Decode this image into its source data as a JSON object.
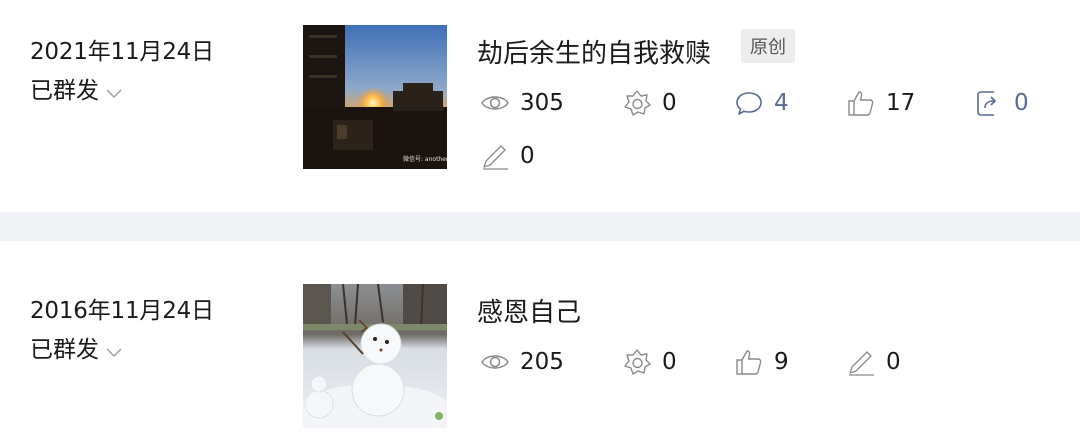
{
  "posts": [
    {
      "date": "2021年11月24日",
      "status": "已群发",
      "title": "劫后余生的自我救赎",
      "badge": "原创",
      "thumb_icon": "sunset-photo",
      "thumb_watermark": "微信号: anothers",
      "stats": {
        "reads": "305",
        "looks": "0",
        "comments": "4",
        "likes": "17",
        "shares": "0",
        "edits": "0"
      }
    },
    {
      "date": "2016年11月24日",
      "status": "已群发",
      "title": "感恩自己",
      "thumb_icon": "snowman-photo",
      "stats": {
        "reads": "205",
        "looks": "0",
        "likes": "9",
        "edits": "0"
      }
    }
  ],
  "colors": {
    "link_blue": "#576b95",
    "icon_gray": "#8a8a8a",
    "separator": "#f1f2f5",
    "badge_bg": "#ededed"
  },
  "icons": [
    "eye-icon",
    "looking-icon",
    "comment-icon",
    "thumb-up-icon",
    "share-icon",
    "pen-icon",
    "chevron-down-icon"
  ]
}
